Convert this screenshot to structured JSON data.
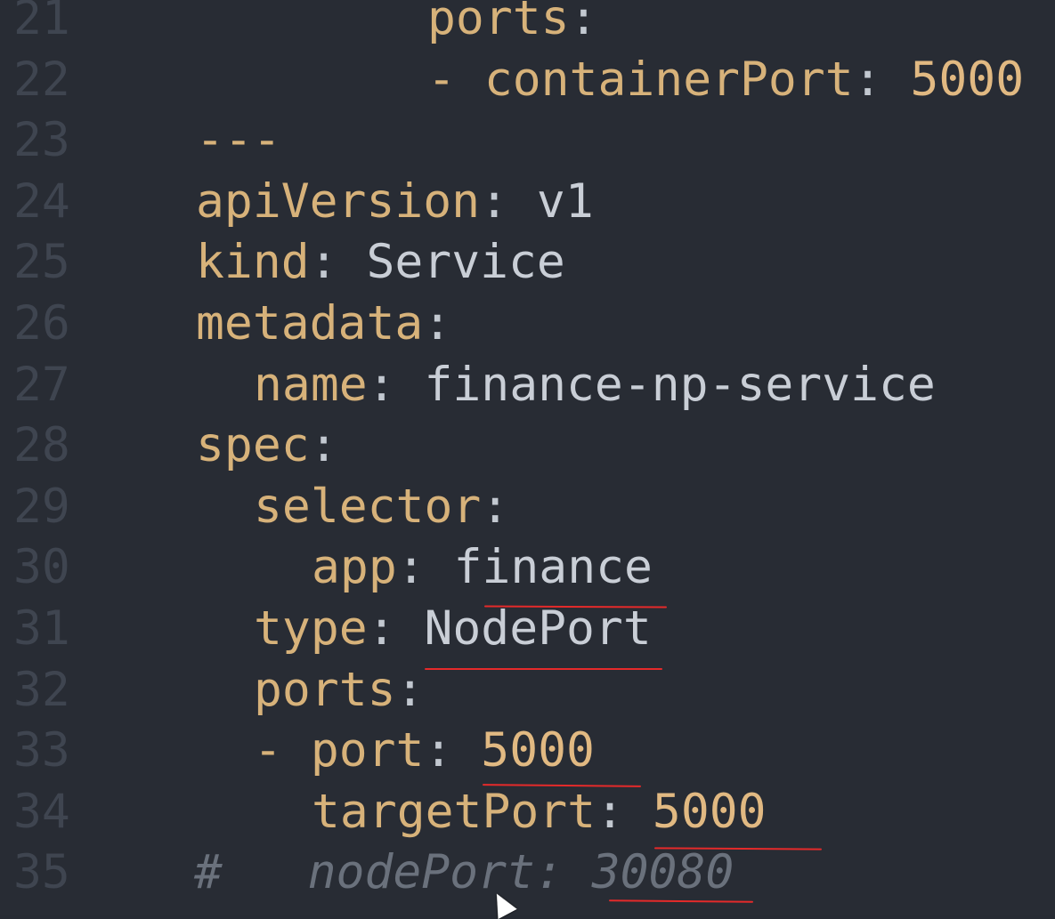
{
  "editor": {
    "lines": [
      {
        "num": "21",
        "tokens": [
          {
            "t": "ports",
            "c": "key"
          },
          {
            "t": ":",
            "c": "punc"
          }
        ]
      },
      {
        "num": "22",
        "tokens": [
          {
            "t": "- ",
            "c": "dash"
          },
          {
            "t": "containerPort",
            "c": "key"
          },
          {
            "t": ": ",
            "c": "punc"
          },
          {
            "t": "5000",
            "c": "num"
          }
        ]
      },
      {
        "num": "23",
        "tokens": [
          {
            "t": "---",
            "c": "dash"
          }
        ]
      },
      {
        "num": "24",
        "tokens": [
          {
            "t": "apiVersion",
            "c": "key"
          },
          {
            "t": ": ",
            "c": "punc"
          },
          {
            "t": "v1",
            "c": "str"
          }
        ]
      },
      {
        "num": "25",
        "tokens": [
          {
            "t": "kind",
            "c": "key"
          },
          {
            "t": ": ",
            "c": "punc"
          },
          {
            "t": "Service",
            "c": "str"
          }
        ]
      },
      {
        "num": "26",
        "tokens": [
          {
            "t": "metadata",
            "c": "key"
          },
          {
            "t": ":",
            "c": "punc"
          }
        ]
      },
      {
        "num": "27",
        "tokens": [
          {
            "t": "name",
            "c": "key"
          },
          {
            "t": ": ",
            "c": "punc"
          },
          {
            "t": "finance-np-service",
            "c": "str"
          }
        ]
      },
      {
        "num": "28",
        "tokens": [
          {
            "t": "spec",
            "c": "key"
          },
          {
            "t": ":",
            "c": "punc"
          }
        ]
      },
      {
        "num": "29",
        "tokens": [
          {
            "t": "selector",
            "c": "key"
          },
          {
            "t": ":",
            "c": "punc"
          }
        ]
      },
      {
        "num": "30",
        "tokens": [
          {
            "t": "app",
            "c": "key"
          },
          {
            "t": ": ",
            "c": "punc"
          },
          {
            "t": "finance",
            "c": "str"
          }
        ]
      },
      {
        "num": "31",
        "tokens": [
          {
            "t": "type",
            "c": "key"
          },
          {
            "t": ": ",
            "c": "punc"
          },
          {
            "t": "NodePort",
            "c": "str"
          }
        ]
      },
      {
        "num": "32",
        "tokens": [
          {
            "t": "ports",
            "c": "key"
          },
          {
            "t": ":",
            "c": "punc"
          }
        ]
      },
      {
        "num": "33",
        "tokens": [
          {
            "t": "- ",
            "c": "dash"
          },
          {
            "t": "port",
            "c": "key"
          },
          {
            "t": ": ",
            "c": "punc"
          },
          {
            "t": "5000",
            "c": "num"
          }
        ]
      },
      {
        "num": "34",
        "tokens": [
          {
            "t": "targetPort",
            "c": "key"
          },
          {
            "t": ": ",
            "c": "punc"
          },
          {
            "t": "5000",
            "c": "num"
          }
        ]
      },
      {
        "num": "35",
        "tokens": [
          {
            "t": "#   nodePort: 30080",
            "c": "comment"
          }
        ]
      }
    ]
  },
  "colors": {
    "background": "#282c34",
    "line_number": "#3f4550",
    "key": "#d7b27a",
    "value": "#c9ced6",
    "number": "#e1b982",
    "comment": "#6a717c",
    "annotation_underline": "#e52a2a"
  },
  "annotations": {
    "underlined_values": [
      "finance",
      "NodePort",
      "5000",
      "5000",
      "30080"
    ]
  }
}
